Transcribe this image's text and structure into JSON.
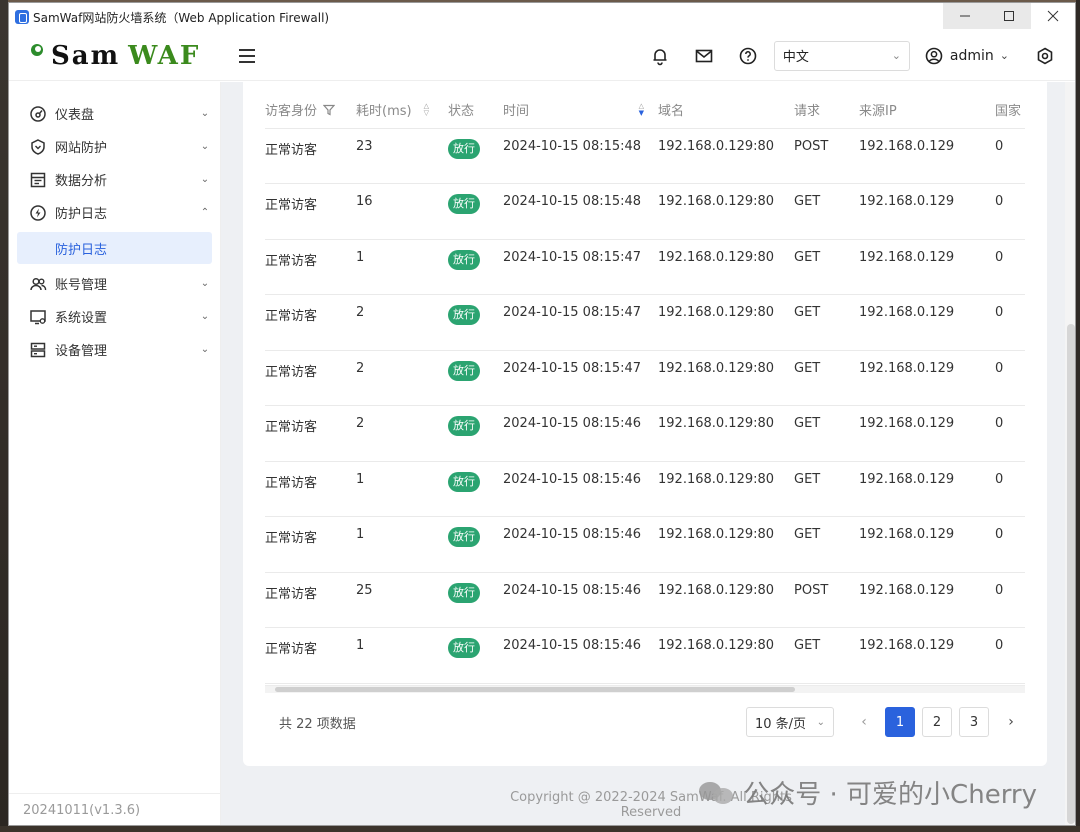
{
  "window": {
    "title": "SamWaf网站防火墙系统（Web Application Firewall)"
  },
  "header": {
    "logo_sam": "Sam",
    "logo_waf": "WAF",
    "language": "中文",
    "username": "admin"
  },
  "sidebar": {
    "items": [
      {
        "label": "仪表盘",
        "icon": "dashboard-icon",
        "expanded": false
      },
      {
        "label": "网站防护",
        "icon": "shield-icon",
        "expanded": false
      },
      {
        "label": "数据分析",
        "icon": "report-icon",
        "expanded": false
      },
      {
        "label": "防护日志",
        "icon": "lightning-icon",
        "expanded": true
      },
      {
        "label": "账号管理",
        "icon": "users-icon",
        "expanded": false
      },
      {
        "label": "系统设置",
        "icon": "settings-monitor-icon",
        "expanded": false
      },
      {
        "label": "设备管理",
        "icon": "server-icon",
        "expanded": false
      }
    ],
    "sub_item": "防护日志",
    "version": "20241011(v1.3.6)"
  },
  "table": {
    "columns": [
      "访客身份",
      "耗时(ms)",
      "状态",
      "时间",
      "域名",
      "请求",
      "来源IP",
      "国家"
    ],
    "rows": [
      {
        "identity": "正常访客",
        "time_ms": "23",
        "status": "放行",
        "time": "2024-10-15 08:15:48",
        "domain": "192.168.0.129:80",
        "method": "POST",
        "ip": "192.168.0.129",
        "country": "0"
      },
      {
        "identity": "正常访客",
        "time_ms": "16",
        "status": "放行",
        "time": "2024-10-15 08:15:48",
        "domain": "192.168.0.129:80",
        "method": "GET",
        "ip": "192.168.0.129",
        "country": "0"
      },
      {
        "identity": "正常访客",
        "time_ms": "1",
        "status": "放行",
        "time": "2024-10-15 08:15:47",
        "domain": "192.168.0.129:80",
        "method": "GET",
        "ip": "192.168.0.129",
        "country": "0"
      },
      {
        "identity": "正常访客",
        "time_ms": "2",
        "status": "放行",
        "time": "2024-10-15 08:15:47",
        "domain": "192.168.0.129:80",
        "method": "GET",
        "ip": "192.168.0.129",
        "country": "0"
      },
      {
        "identity": "正常访客",
        "time_ms": "2",
        "status": "放行",
        "time": "2024-10-15 08:15:47",
        "domain": "192.168.0.129:80",
        "method": "GET",
        "ip": "192.168.0.129",
        "country": "0"
      },
      {
        "identity": "正常访客",
        "time_ms": "2",
        "status": "放行",
        "time": "2024-10-15 08:15:46",
        "domain": "192.168.0.129:80",
        "method": "GET",
        "ip": "192.168.0.129",
        "country": "0"
      },
      {
        "identity": "正常访客",
        "time_ms": "1",
        "status": "放行",
        "time": "2024-10-15 08:15:46",
        "domain": "192.168.0.129:80",
        "method": "GET",
        "ip": "192.168.0.129",
        "country": "0"
      },
      {
        "identity": "正常访客",
        "time_ms": "1",
        "status": "放行",
        "time": "2024-10-15 08:15:46",
        "domain": "192.168.0.129:80",
        "method": "GET",
        "ip": "192.168.0.129",
        "country": "0"
      },
      {
        "identity": "正常访客",
        "time_ms": "25",
        "status": "放行",
        "time": "2024-10-15 08:15:46",
        "domain": "192.168.0.129:80",
        "method": "POST",
        "ip": "192.168.0.129",
        "country": "0"
      },
      {
        "identity": "正常访客",
        "time_ms": "1",
        "status": "放行",
        "time": "2024-10-15 08:15:46",
        "domain": "192.168.0.129:80",
        "method": "GET",
        "ip": "192.168.0.129",
        "country": "0"
      }
    ]
  },
  "pagination": {
    "total_text": "共 22 项数据",
    "page_size": "10 条/页",
    "pages": [
      "1",
      "2",
      "3"
    ],
    "current_page": "1"
  },
  "footer": {
    "copyright": "Copyright @ 2022-2024 SamWaf. All Rights Reserved"
  },
  "watermark": {
    "text": "公众号 · 可爱的小Cherry"
  },
  "colors": {
    "accent": "#2a62dd",
    "status_pass": "#2ba471",
    "logo_green": "#3b8a1d"
  }
}
